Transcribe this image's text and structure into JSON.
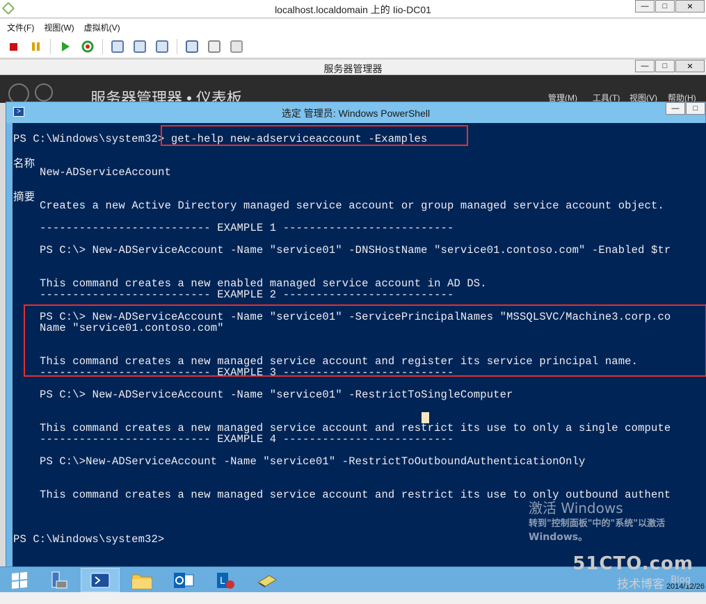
{
  "vmware": {
    "title": "localhost.localdomain 上的 Iio-DC01",
    "menu": [
      "文件(F)",
      "视图(W)",
      "虚拟机(V)"
    ],
    "toolbar_icons": [
      "stop-icon",
      "pause-icon",
      "play-icon",
      "reset-icon",
      "snapshot-icon",
      "revert-snapshot-icon",
      "manage-snapshot-icon",
      "send-keys-icon",
      "settings-icon",
      "tools-icon"
    ]
  },
  "window_buttons": {
    "minimize": "—",
    "maximize": "□",
    "close": "✕"
  },
  "server_manager": {
    "title": "服务器管理器",
    "breadcrumb": "服务器管理器 • 仪表板",
    "menus": [
      "管理(M)",
      "工具(T)",
      "视图(V)",
      "帮助(H)"
    ]
  },
  "powershell": {
    "title": "选定 管理员: Windows PowerShell",
    "lines": [
      "PS C:\\Windows\\system32> get-help new-adserviceaccount -Examples",
      "名称",
      "New-ADServiceAccount",
      "摘要",
      "Creates a new Active Directory managed service account or group managed service account object.",
      "-------------------------- EXAMPLE 1 --------------------------",
      "PS C:\\> New-ADServiceAccount -Name \"service01\" -DNSHostName \"service01.contoso.com\" -Enabled $tr",
      "This command creates a new enabled managed service account in AD DS.",
      "-------------------------- EXAMPLE 2 --------------------------",
      "PS C:\\> New-ADServiceAccount -Name \"service01\" -ServicePrincipalNames \"MSSQLSVC/Machine3.corp.co",
      "Name \"service01.contoso.com\"",
      "This command creates a new managed service account and register its service principal name.",
      "-------------------------- EXAMPLE 3 --------------------------",
      "PS C:\\> New-ADServiceAccount -Name \"service01\" -RestrictToSingleComputer",
      "This command creates a new managed service account and restrict its use to only a single compute",
      "-------------------------- EXAMPLE 4 --------------------------",
      "PS C:\\>New-ADServiceAccount -Name \"service01\" -RestrictToOutboundAuthenticationOnly",
      "This command creates a new managed service account and restrict its use to only outbound authent",
      "PS C:\\Windows\\system32>"
    ]
  },
  "activation": {
    "title": "激活 Windows",
    "text1": "转到\"控制面板\"中的\"系统\"以激活",
    "text2": "Windows。"
  },
  "taskbar": {
    "items": [
      "start-button",
      "server-manager",
      "powershell",
      "file-explorer",
      "outlook",
      "lync",
      "notepad"
    ],
    "date": "2014/12/26"
  },
  "brand": {
    "site": "51CTO.com",
    "blog": "技术博客",
    "tag": "Blog"
  }
}
